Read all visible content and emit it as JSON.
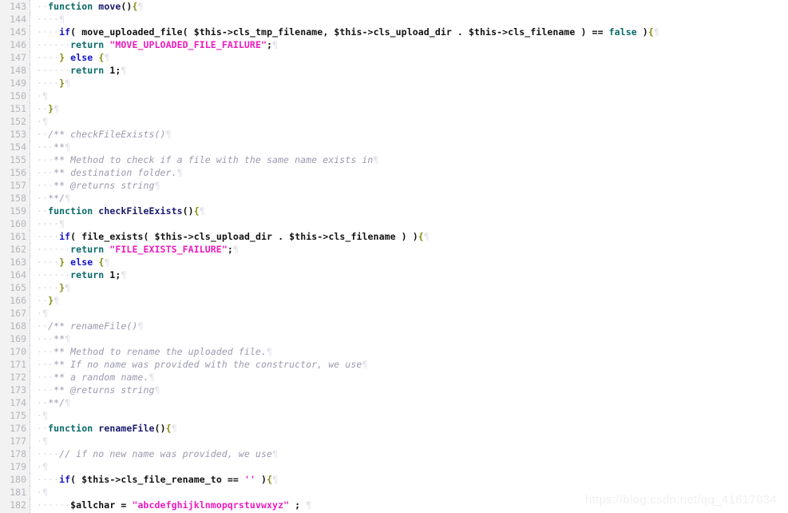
{
  "editor": {
    "language": "php",
    "first_line": 143,
    "last_line": 182,
    "show_whitespace": true,
    "whitespace_dot": "·",
    "pilcrow": "¶",
    "colors": {
      "background": "#ffffff",
      "gutter_background": "#f2f2f2",
      "gutter_text": "#b5b5bd",
      "keyword_teal": "#0b6a6a",
      "keyword_blue": "#1414c8",
      "function_name": "#1a1a6e",
      "string": "#ec1ac0",
      "comment": "#9a9ab0",
      "brace": "#8a8a12",
      "whitespace_marker": "#d8d8e2",
      "watermark": "#f0f0f2"
    }
  },
  "watermark": {
    "text": "https://blog.csdn.net/qq_41617034"
  },
  "lines": [
    {
      "n": "143",
      "tokens": [
        {
          "t": "··",
          "c": "ws"
        },
        {
          "t": "function",
          "c": "kw"
        },
        {
          "t": " ",
          "c": "op"
        },
        {
          "t": "move",
          "c": "fn"
        },
        {
          "t": "()",
          "c": "op"
        },
        {
          "t": "{",
          "c": "brace"
        },
        {
          "t": "¶",
          "c": "pil"
        }
      ]
    },
    {
      "n": "144",
      "tokens": [
        {
          "t": "····",
          "c": "ws"
        },
        {
          "t": "¶",
          "c": "pil"
        }
      ]
    },
    {
      "n": "145",
      "tokens": [
        {
          "t": "····",
          "c": "ws"
        },
        {
          "t": "if",
          "c": "kw2"
        },
        {
          "t": "( ",
          "c": "op"
        },
        {
          "t": "move_uploaded_file",
          "c": "id"
        },
        {
          "t": "( ",
          "c": "op"
        },
        {
          "t": "$this",
          "c": "id"
        },
        {
          "t": "->",
          "c": "op"
        },
        {
          "t": "cls_tmp_filename",
          "c": "id"
        },
        {
          "t": ", ",
          "c": "op"
        },
        {
          "t": "$this",
          "c": "id"
        },
        {
          "t": "->",
          "c": "op"
        },
        {
          "t": "cls_upload_dir",
          "c": "id"
        },
        {
          "t": " . ",
          "c": "op"
        },
        {
          "t": "$this",
          "c": "id"
        },
        {
          "t": "->",
          "c": "op"
        },
        {
          "t": "cls_filename",
          "c": "id"
        },
        {
          "t": " ) == ",
          "c": "op"
        },
        {
          "t": "false",
          "c": "kw"
        },
        {
          "t": " )",
          "c": "op"
        },
        {
          "t": "{",
          "c": "brace"
        },
        {
          "t": "¶",
          "c": "pil"
        }
      ]
    },
    {
      "n": "146",
      "tokens": [
        {
          "t": "······",
          "c": "ws"
        },
        {
          "t": "return",
          "c": "kw"
        },
        {
          "t": " ",
          "c": "op"
        },
        {
          "t": "\"MOVE_UPLOADED_FILE_FAILURE\"",
          "c": "str"
        },
        {
          "t": ";",
          "c": "op"
        },
        {
          "t": "¶",
          "c": "pil"
        }
      ]
    },
    {
      "n": "147",
      "tokens": [
        {
          "t": "····",
          "c": "ws"
        },
        {
          "t": "}",
          "c": "brace"
        },
        {
          "t": " ",
          "c": "op"
        },
        {
          "t": "else",
          "c": "kw2"
        },
        {
          "t": " ",
          "c": "op"
        },
        {
          "t": "{",
          "c": "brace"
        },
        {
          "t": "¶",
          "c": "pil"
        }
      ]
    },
    {
      "n": "148",
      "tokens": [
        {
          "t": "······",
          "c": "ws"
        },
        {
          "t": "return",
          "c": "kw"
        },
        {
          "t": " ",
          "c": "op"
        },
        {
          "t": "1",
          "c": "num"
        },
        {
          "t": ";",
          "c": "op"
        },
        {
          "t": "¶",
          "c": "pil"
        }
      ]
    },
    {
      "n": "149",
      "tokens": [
        {
          "t": "····",
          "c": "ws"
        },
        {
          "t": "}",
          "c": "brace"
        },
        {
          "t": "¶",
          "c": "pil"
        }
      ]
    },
    {
      "n": "150",
      "tokens": [
        {
          "t": "·",
          "c": "ws"
        },
        {
          "t": "¶",
          "c": "pil"
        }
      ]
    },
    {
      "n": "151",
      "tokens": [
        {
          "t": "··",
          "c": "ws"
        },
        {
          "t": "}",
          "c": "brace"
        },
        {
          "t": "¶",
          "c": "pil"
        }
      ]
    },
    {
      "n": "152",
      "tokens": [
        {
          "t": "·",
          "c": "ws"
        },
        {
          "t": "¶",
          "c": "pil"
        }
      ]
    },
    {
      "n": "153",
      "tokens": [
        {
          "t": "··",
          "c": "ws"
        },
        {
          "t": "/** checkFileExists()",
          "c": "cmt"
        },
        {
          "t": "¶",
          "c": "pil"
        }
      ]
    },
    {
      "n": "154",
      "tokens": [
        {
          "t": "···",
          "c": "ws"
        },
        {
          "t": "**",
          "c": "cmt"
        },
        {
          "t": "¶",
          "c": "pil"
        }
      ]
    },
    {
      "n": "155",
      "tokens": [
        {
          "t": "···",
          "c": "ws"
        },
        {
          "t": "** Method to check if a file with the same name exists in",
          "c": "cmt"
        },
        {
          "t": "¶",
          "c": "pil"
        }
      ]
    },
    {
      "n": "156",
      "tokens": [
        {
          "t": "···",
          "c": "ws"
        },
        {
          "t": "** destination folder.",
          "c": "cmt"
        },
        {
          "t": "¶",
          "c": "pil"
        }
      ]
    },
    {
      "n": "157",
      "tokens": [
        {
          "t": "···",
          "c": "ws"
        },
        {
          "t": "** @returns string",
          "c": "cmt"
        },
        {
          "t": "¶",
          "c": "pil"
        }
      ]
    },
    {
      "n": "158",
      "tokens": [
        {
          "t": "··",
          "c": "ws"
        },
        {
          "t": "**/",
          "c": "cmt"
        },
        {
          "t": "¶",
          "c": "pil"
        }
      ]
    },
    {
      "n": "159",
      "tokens": [
        {
          "t": "··",
          "c": "ws"
        },
        {
          "t": "function",
          "c": "kw"
        },
        {
          "t": " ",
          "c": "op"
        },
        {
          "t": "checkFileExists",
          "c": "fn"
        },
        {
          "t": "()",
          "c": "op"
        },
        {
          "t": "{",
          "c": "brace"
        },
        {
          "t": "¶",
          "c": "pil"
        }
      ]
    },
    {
      "n": "160",
      "tokens": [
        {
          "t": "····",
          "c": "ws"
        },
        {
          "t": "¶",
          "c": "pil"
        }
      ]
    },
    {
      "n": "161",
      "tokens": [
        {
          "t": "····",
          "c": "ws"
        },
        {
          "t": "if",
          "c": "kw2"
        },
        {
          "t": "( ",
          "c": "op"
        },
        {
          "t": "file_exists",
          "c": "id"
        },
        {
          "t": "( ",
          "c": "op"
        },
        {
          "t": "$this",
          "c": "id"
        },
        {
          "t": "->",
          "c": "op"
        },
        {
          "t": "cls_upload_dir",
          "c": "id"
        },
        {
          "t": " . ",
          "c": "op"
        },
        {
          "t": "$this",
          "c": "id"
        },
        {
          "t": "->",
          "c": "op"
        },
        {
          "t": "cls_filename",
          "c": "id"
        },
        {
          "t": " ) )",
          "c": "op"
        },
        {
          "t": "{",
          "c": "brace"
        },
        {
          "t": "¶",
          "c": "pil"
        }
      ]
    },
    {
      "n": "162",
      "tokens": [
        {
          "t": "······",
          "c": "ws"
        },
        {
          "t": "return",
          "c": "kw"
        },
        {
          "t": " ",
          "c": "op"
        },
        {
          "t": "\"FILE_EXISTS_FAILURE\"",
          "c": "str"
        },
        {
          "t": ";",
          "c": "op"
        },
        {
          "t": "¶",
          "c": "pil"
        }
      ]
    },
    {
      "n": "163",
      "tokens": [
        {
          "t": "····",
          "c": "ws"
        },
        {
          "t": "}",
          "c": "brace"
        },
        {
          "t": " ",
          "c": "op"
        },
        {
          "t": "else",
          "c": "kw2"
        },
        {
          "t": " ",
          "c": "op"
        },
        {
          "t": "{",
          "c": "brace"
        },
        {
          "t": "¶",
          "c": "pil"
        }
      ]
    },
    {
      "n": "164",
      "tokens": [
        {
          "t": "······",
          "c": "ws"
        },
        {
          "t": "return",
          "c": "kw"
        },
        {
          "t": " ",
          "c": "op"
        },
        {
          "t": "1",
          "c": "num"
        },
        {
          "t": ";",
          "c": "op"
        },
        {
          "t": "¶",
          "c": "pil"
        }
      ]
    },
    {
      "n": "165",
      "tokens": [
        {
          "t": "····",
          "c": "ws"
        },
        {
          "t": "}",
          "c": "brace"
        },
        {
          "t": "¶",
          "c": "pil"
        }
      ]
    },
    {
      "n": "166",
      "tokens": [
        {
          "t": "··",
          "c": "ws"
        },
        {
          "t": "}",
          "c": "brace"
        },
        {
          "t": "¶",
          "c": "pil"
        }
      ]
    },
    {
      "n": "167",
      "tokens": [
        {
          "t": "·",
          "c": "ws"
        },
        {
          "t": "¶",
          "c": "pil"
        }
      ]
    },
    {
      "n": "168",
      "tokens": [
        {
          "t": "··",
          "c": "ws"
        },
        {
          "t": "/** renameFile()",
          "c": "cmt"
        },
        {
          "t": "¶",
          "c": "pil"
        }
      ]
    },
    {
      "n": "169",
      "tokens": [
        {
          "t": "···",
          "c": "ws"
        },
        {
          "t": "**",
          "c": "cmt"
        },
        {
          "t": "¶",
          "c": "pil"
        }
      ]
    },
    {
      "n": "170",
      "tokens": [
        {
          "t": "···",
          "c": "ws"
        },
        {
          "t": "** Method to rename the uploaded file.",
          "c": "cmt"
        },
        {
          "t": "¶",
          "c": "pil"
        }
      ]
    },
    {
      "n": "171",
      "tokens": [
        {
          "t": "···",
          "c": "ws"
        },
        {
          "t": "** If no name was provided with the constructor, we use",
          "c": "cmt"
        },
        {
          "t": "¶",
          "c": "pil"
        }
      ]
    },
    {
      "n": "172",
      "tokens": [
        {
          "t": "···",
          "c": "ws"
        },
        {
          "t": "** a random name.",
          "c": "cmt"
        },
        {
          "t": "¶",
          "c": "pil"
        }
      ]
    },
    {
      "n": "173",
      "tokens": [
        {
          "t": "···",
          "c": "ws"
        },
        {
          "t": "** @returns string",
          "c": "cmt"
        },
        {
          "t": "¶",
          "c": "pil"
        }
      ]
    },
    {
      "n": "174",
      "tokens": [
        {
          "t": "··",
          "c": "ws"
        },
        {
          "t": "**/",
          "c": "cmt"
        },
        {
          "t": "¶",
          "c": "pil"
        }
      ]
    },
    {
      "n": "175",
      "tokens": [
        {
          "t": "·",
          "c": "ws"
        },
        {
          "t": "¶",
          "c": "pil"
        }
      ]
    },
    {
      "n": "176",
      "tokens": [
        {
          "t": "··",
          "c": "ws"
        },
        {
          "t": "function",
          "c": "kw"
        },
        {
          "t": " ",
          "c": "op"
        },
        {
          "t": "renameFile",
          "c": "fn"
        },
        {
          "t": "()",
          "c": "op"
        },
        {
          "t": "{",
          "c": "brace"
        },
        {
          "t": "¶",
          "c": "pil"
        }
      ]
    },
    {
      "n": "177",
      "tokens": [
        {
          "t": "·",
          "c": "ws"
        },
        {
          "t": "¶",
          "c": "pil"
        }
      ]
    },
    {
      "n": "178",
      "tokens": [
        {
          "t": "····",
          "c": "ws"
        },
        {
          "t": "// if no new name was provided, we use",
          "c": "cmt"
        },
        {
          "t": "¶",
          "c": "pil"
        }
      ]
    },
    {
      "n": "179",
      "tokens": [
        {
          "t": "·",
          "c": "ws"
        },
        {
          "t": "¶",
          "c": "pil"
        }
      ]
    },
    {
      "n": "180",
      "tokens": [
        {
          "t": "····",
          "c": "ws"
        },
        {
          "t": "if",
          "c": "kw2"
        },
        {
          "t": "( ",
          "c": "op"
        },
        {
          "t": "$this",
          "c": "id"
        },
        {
          "t": "->",
          "c": "op"
        },
        {
          "t": "cls_file_rename_to",
          "c": "id"
        },
        {
          "t": " == ",
          "c": "op"
        },
        {
          "t": "''",
          "c": "str"
        },
        {
          "t": " )",
          "c": "op"
        },
        {
          "t": "{",
          "c": "brace"
        },
        {
          "t": "¶",
          "c": "pil"
        }
      ]
    },
    {
      "n": "181",
      "tokens": [
        {
          "t": "·",
          "c": "ws"
        },
        {
          "t": "¶",
          "c": "pil"
        }
      ]
    },
    {
      "n": "182",
      "tokens": [
        {
          "t": "······",
          "c": "ws"
        },
        {
          "t": "$allchar",
          "c": "id"
        },
        {
          "t": " = ",
          "c": "op"
        },
        {
          "t": "\"abcdefghijklnmopqrstuvwxyz\"",
          "c": "str"
        },
        {
          "t": " ; ",
          "c": "op"
        },
        {
          "t": "¶",
          "c": "pil"
        }
      ]
    }
  ]
}
